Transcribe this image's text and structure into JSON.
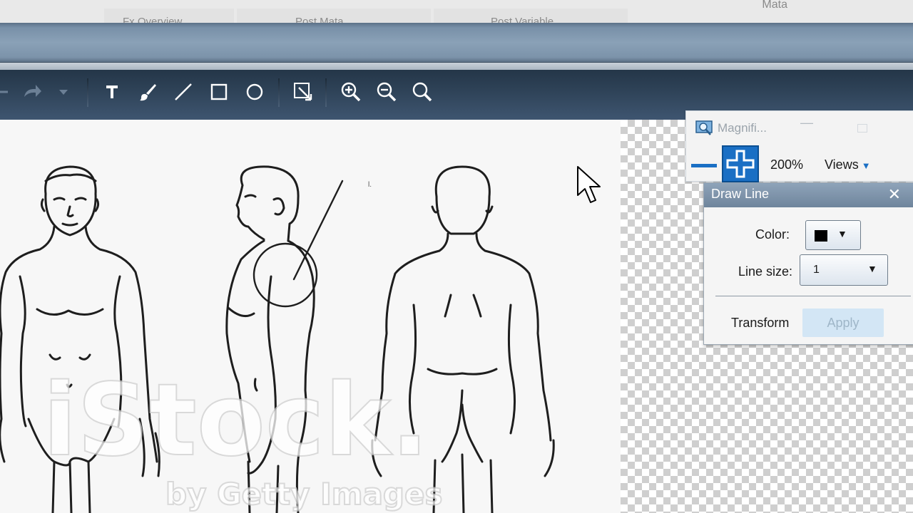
{
  "top_strip": {
    "tabs": [
      "Fx Overview",
      "Post Mata",
      "Post Variable"
    ],
    "right_label": "Mata"
  },
  "toolbar": {
    "tools": [
      {
        "name": "redo",
        "icon": "redo-arrow-icon"
      },
      {
        "name": "redo-dropdown",
        "icon": "chevron-down-icon"
      },
      {
        "name": "text",
        "icon": "text-tool-icon"
      },
      {
        "name": "brush",
        "icon": "brush-icon"
      },
      {
        "name": "line",
        "icon": "line-tool-icon"
      },
      {
        "name": "rectangle",
        "icon": "rectangle-tool-icon"
      },
      {
        "name": "ellipse",
        "icon": "ellipse-tool-icon"
      },
      {
        "name": "crop",
        "icon": "crop-select-icon"
      },
      {
        "name": "zoom-in",
        "icon": "zoom-in-icon"
      },
      {
        "name": "zoom-out",
        "icon": "zoom-out-icon"
      },
      {
        "name": "zoom-fit",
        "icon": "magnifier-icon"
      }
    ]
  },
  "canvas": {
    "watermark_main": "iStock.",
    "watermark_sub": "by Getty Images",
    "stray_mark": "l."
  },
  "magnifier": {
    "title": "Magnifi...",
    "zoom_level": "200%",
    "views_label": "Views"
  },
  "draw_line": {
    "title": "Draw Line",
    "color_label": "Color:",
    "color_value": "#000000",
    "line_size_label": "Line size:",
    "line_size_value": "1",
    "transform_label": "Transform",
    "apply_label": "Apply"
  },
  "colors": {
    "toolbar_bg": "#2e4257",
    "accent": "#1a6fc4",
    "panel_header": "#7f95ab"
  }
}
